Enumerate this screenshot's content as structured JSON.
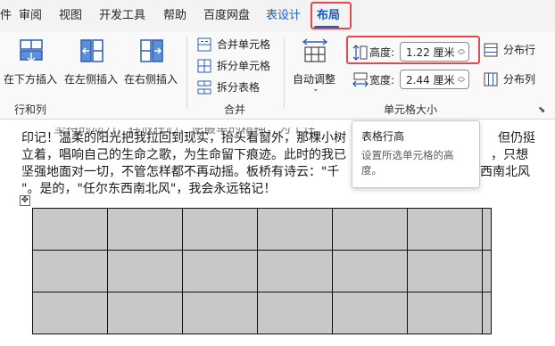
{
  "tabs": [
    {
      "label": "件"
    },
    {
      "label": "审阅"
    },
    {
      "label": "视图"
    },
    {
      "label": "开发工具"
    },
    {
      "label": "帮助"
    },
    {
      "label": "百度网盘"
    },
    {
      "label": "表设计"
    },
    {
      "label": "布局"
    }
  ],
  "ribbon": {
    "rows_cols": {
      "insert_below": "在下方插入",
      "insert_left": "在左侧插入",
      "insert_right": "在右侧插入",
      "group_label": "行和列"
    },
    "merge": {
      "merge_cells": "合并单元格",
      "split_cells": "拆分单元格",
      "split_table": "拆分表格",
      "group_label": "合并"
    },
    "cell_size": {
      "autofit": "自动调整",
      "height_label": "高度:",
      "height_value": "1.22 厘米",
      "width_label": "宽度:",
      "width_value": "2.44 厘米",
      "distribute_rows": "分布行",
      "distribute_cols": "分布列",
      "group_label": "单元格大小"
    }
  },
  "document": {
    "lines": [
      "印记！温柔的阳光把我拉回到现实，抬头看窗外，那棵小树",
      "立着，唱响自己的生命之歌，为生命留下痕迹。此时的我已",
      "坚强地面对一切，不管怎样都不再动摇。板桥有诗云：\"千",
      "\"。是的，\"任尔东西南北风\"，我会永远铭记！"
    ],
    "right_fragments": [
      "但仍挺",
      "，只想",
      "西南北风"
    ]
  },
  "tooltip": {
    "title": "表格行高",
    "description": "设置所选单元格的高度。"
  },
  "colors": {
    "accent": "#185abd",
    "highlight_border": "#e5484d",
    "cell_fill": "#c8c8c8"
  }
}
